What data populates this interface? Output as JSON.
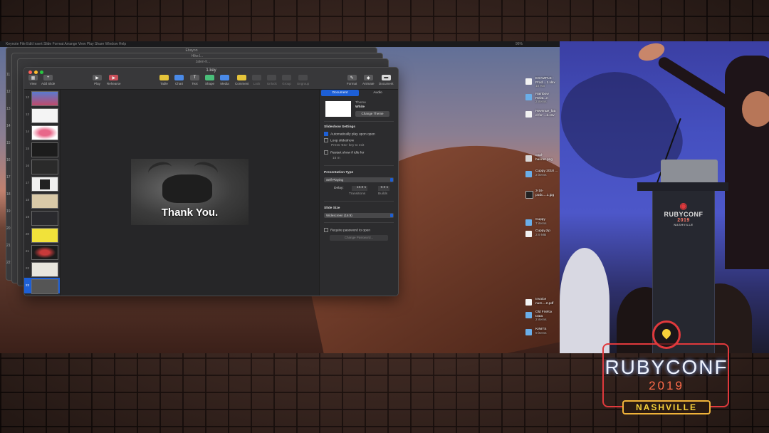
{
  "colors": {
    "accent": "#1d5fd6",
    "brand_red": "#e0393c",
    "brand_yellow": "#f7d13a"
  },
  "menubar": {
    "items": "Keynote   File   Edit   Insert   Slide   Format   Arrange   View   Play   Share   Window   Help",
    "status": "96%"
  },
  "ghost_windows": {
    "titles": [
      "Ebayon",
      "Hike.l...",
      "Jalen-h..."
    ],
    "slide_numbers": [
      "11",
      "12",
      "13",
      "14",
      "15",
      "16",
      "17",
      "18",
      "19",
      "20",
      "21",
      "22"
    ]
  },
  "window": {
    "title": "1.key",
    "toolbar": {
      "view": "View",
      "add_slide": "Add Slide",
      "play": "Play",
      "rehearse": "Rehearse",
      "table": "Table",
      "chart": "Chart",
      "text": "Text",
      "shape": "Shape",
      "media": "Media",
      "comment": "Comment",
      "lock": "Lock",
      "unlock": "Unlock",
      "group": "Group",
      "ungroup": "Ungroup",
      "format": "Format",
      "animate": "Animate",
      "document": "Document"
    },
    "navigator": {
      "slides": [
        {
          "num": "12"
        },
        {
          "num": "13"
        },
        {
          "num": "14"
        },
        {
          "num": "15"
        },
        {
          "num": "16"
        },
        {
          "num": "17"
        },
        {
          "num": "18"
        },
        {
          "num": "19"
        },
        {
          "num": "20"
        },
        {
          "num": "21"
        },
        {
          "num": "22"
        },
        {
          "num": "23"
        }
      ]
    },
    "slide": {
      "text": "Thank You."
    },
    "inspector": {
      "tabs": [
        "Document",
        "Audio"
      ],
      "theme_label": "Theme",
      "theme_value": "White",
      "change_theme": "Change Theme",
      "slideshow_settings": "Slideshow Settings",
      "auto_play": "Automatically play upon open",
      "loop": "Loop slideshow",
      "loop_hint": "Press 'Esc' key to exit",
      "restart": "Restart show if idle for",
      "idle_value": "15 m",
      "presentation_type": "Presentation Type",
      "presentation_value": "Self-Playing",
      "delay_label": "Delay:",
      "transitions_value": "10.0 s",
      "transitions_label": "Transitions",
      "builds_value": "0.0 s",
      "builds_label": "Builds",
      "slide_size": "Slide Size",
      "slide_size_value": "Widescreen (16:9)",
      "require_password": "Require password to open",
      "change_password": "Change Password..."
    }
  },
  "desktop_icons": [
    {
      "name": "EXAMPLE - Prod....1.xlsx",
      "sub": "10 KB"
    },
    {
      "name": "Rainbow Relat...n",
      "sub": "2 items"
    },
    {
      "name": "Revenue_loa d-for-...d.csv",
      "sub": ""
    },
    {
      "name": "coal-banner.png",
      "sub": ""
    },
    {
      "name": "Cuppy 2018 ...",
      "sub": "2 items"
    },
    {
      "name": "3-16-podc....1.jpg",
      "sub": ""
    },
    {
      "name": "Cuppy",
      "sub": "7 items"
    },
    {
      "name": "Cuppy.zip",
      "sub": "2.9 MB"
    },
    {
      "name": "Invoice num....2.pdf",
      "sub": ""
    },
    {
      "name": "Old Firefox Data",
      "sub": "2 items"
    },
    {
      "name": "KINITS",
      "sub": "9 items"
    }
  ],
  "podium": {
    "name": "RUBYCONF",
    "year": "2019",
    "city": "NASHVILLE"
  },
  "logo": {
    "name": "RUBYCONF",
    "year": "2019",
    "city": "NASHVILLE"
  }
}
